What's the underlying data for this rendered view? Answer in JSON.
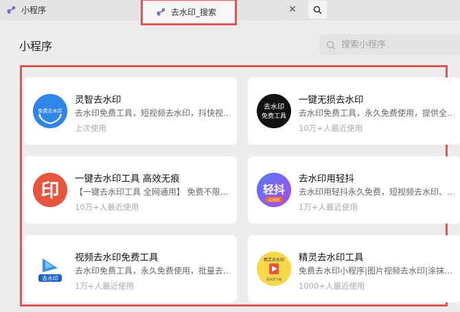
{
  "tabs": [
    {
      "label": "小程序",
      "active": false
    },
    {
      "label": "去水印_搜索",
      "active": true
    }
  ],
  "tab_close_symbol": "✕",
  "section": {
    "title": "小程序"
  },
  "search": {
    "placeholder": "搜索小程序"
  },
  "colors": {
    "highlight": "#e05555",
    "card_bg": "#ffffff",
    "page_bg": "#ededed"
  },
  "results": [
    {
      "name": "灵智去水印",
      "desc": "去水印免费工具，短视频去水印，抖快视…",
      "usage": "上次使用",
      "logo_text": "免费去水印",
      "logo_bg": "#2f86e8"
    },
    {
      "name": "一键无损去水印",
      "desc": "去水印免费工具，永久免费使用，提供全…",
      "usage": "10万+人最近使用",
      "logo_text": "去水印\n免费工具",
      "logo_bg": "#111111"
    },
    {
      "name": "一键去水印工具 高效无痕",
      "desc": "【一键去水印工具 全网通用】 免费不限…",
      "usage": "10万+人最近使用",
      "logo_text": "印",
      "logo_bg": "#e8553f"
    },
    {
      "name": "去水印用轻抖",
      "desc": "去水印用轻抖永久免费，短视频去水印、…",
      "usage": "1万+人最近使用",
      "logo_text": "轻抖",
      "logo_bg": "#7a4df0"
    },
    {
      "name": "视频去水印免费工具",
      "desc": "去水印免费工具，永久免费使用，批量去…",
      "usage": "1万+人最近使用",
      "logo_text": "去水印",
      "logo_bg": "#ffffff"
    },
    {
      "name": "精灵去水印工具",
      "desc": "免费去水印小程序|图片视频去水印|涂抹…",
      "usage": "1000+人最近使用",
      "logo_text": "精灵去水印",
      "logo_bg": "#f7d84a"
    }
  ]
}
